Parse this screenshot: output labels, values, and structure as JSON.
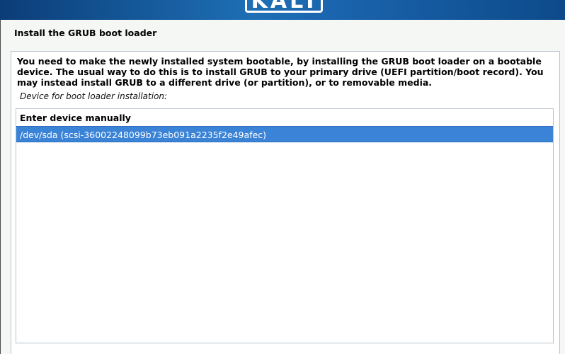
{
  "banner": {
    "logo_text": "KALI"
  },
  "page": {
    "title": "Install the GRUB boot loader"
  },
  "content": {
    "description": "You need to make the newly installed system bootable, by installing the GRUB boot loader on a bootable device. The usual way to do this is to install GRUB to your primary drive (UEFI partition/boot record). You may instead install GRUB to a different drive (or partition), or to removable media.",
    "question": "Device for boot loader installation:"
  },
  "device_list": {
    "items": [
      {
        "label": "Enter device manually",
        "selected": false
      },
      {
        "label": "/dev/sda  (scsi-36002248099b73eb091a2235f2e49afec)",
        "selected": true
      }
    ]
  },
  "colors": {
    "selection": "#3a83d6",
    "banner": "#1e6fb5",
    "background": "#f4f7f4"
  }
}
